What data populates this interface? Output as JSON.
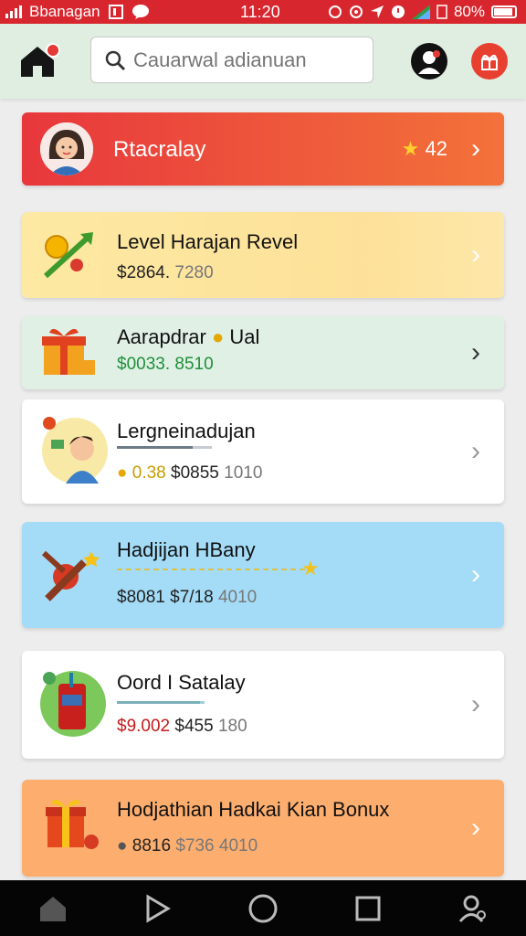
{
  "status_bar": {
    "carrier": "Bbanagan",
    "time": "11:20",
    "battery": "80%"
  },
  "header": {
    "search_placeholder": "Cauarwal adianuan",
    "home_icon": "home-icon",
    "profile_icon": "profile-icon",
    "gift_icon": "gift-icon"
  },
  "profile_card": {
    "name": "Rtacralay",
    "stars": "42"
  },
  "cards": [
    {
      "title": "Level Harajan Revel",
      "amount": "$2864.",
      "amount_dim": "7280"
    },
    {
      "title": "Aarapdrar",
      "title_suffix": "Ual",
      "amount": "$0033.",
      "amount_dim": "8510"
    },
    {
      "title": "Lergneinadujan",
      "coins": "0.38",
      "amount": "$0855",
      "amount_dim": "1010"
    },
    {
      "title": "Hadjijan HBany",
      "amount": "$8081",
      "amount_dim": "$7/18",
      "amount_dim2": "4010"
    },
    {
      "title": "Oord I Satalay",
      "amount": "$9.002",
      "amount_dim": "$455",
      "amount_dim2": "180"
    },
    {
      "title": "Hodjathian Hadkai Kian Bonux",
      "amount": "8816",
      "amount_dim": "$736",
      "amount_dim2": "4010"
    }
  ],
  "colors": {
    "status_bar": "#d8262e",
    "header_bg": "#dfeee0",
    "nav_bg": "#050505",
    "green_text": "#1f8f3a",
    "red_text": "#c41a1a",
    "gold_text": "#c89b00"
  }
}
